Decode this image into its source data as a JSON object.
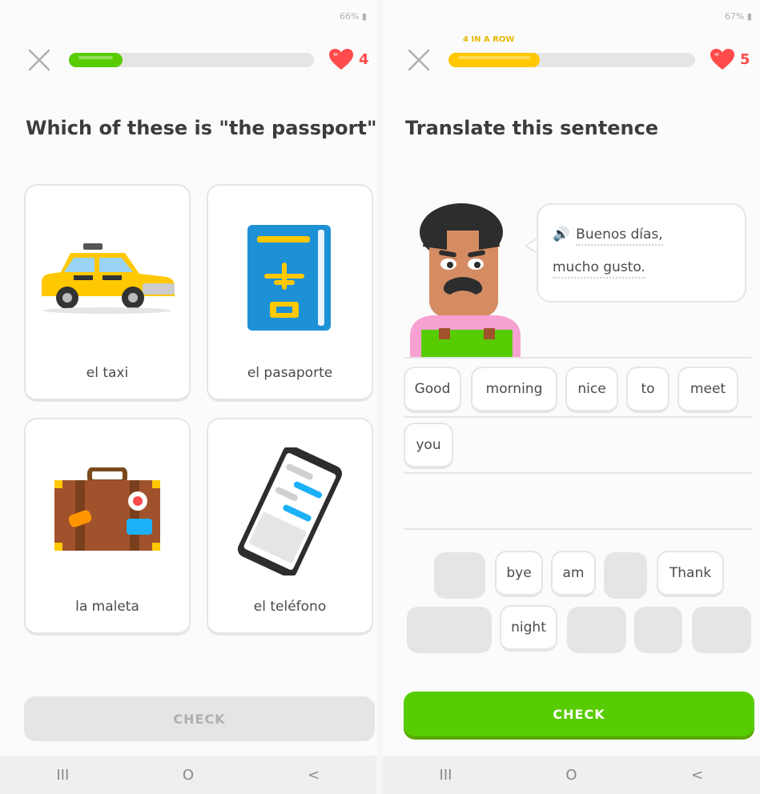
{
  "left": {
    "status": {
      "battery": "66%"
    },
    "progress": {
      "fraction": 0.22,
      "color": "#58cc02"
    },
    "hearts": {
      "count": "4"
    },
    "title": "Which of these is \"the passport\"?",
    "cards": [
      {
        "label": "el taxi",
        "icon": "taxi-icon"
      },
      {
        "label": "el pasaporte",
        "icon": "passport-icon"
      },
      {
        "label": "la maleta",
        "icon": "suitcase-icon"
      },
      {
        "label": "el teléfono",
        "icon": "phone-icon"
      }
    ],
    "check_label": "CHECK"
  },
  "right": {
    "status": {
      "battery": "67%"
    },
    "streak": "4 IN A ROW",
    "progress": {
      "fraction": 0.37,
      "color": "#ffc800"
    },
    "hearts": {
      "count": "5"
    },
    "title": "Translate this sentence",
    "bubble": {
      "line1": "Buenos días,",
      "line2": "mucho gusto."
    },
    "answer_words": [
      "Good",
      "morning",
      "nice",
      "to",
      "meet",
      "you"
    ],
    "word_bank": [
      "bye",
      "am",
      "Thank",
      "night"
    ],
    "check_label": "CHECK"
  },
  "colors": {
    "green": "#58cc02",
    "yellow": "#ffc800",
    "red": "#ff4b4b",
    "blue": "#1cb0f6"
  },
  "navbar": {
    "recent": "III",
    "home": "O",
    "back": "<"
  }
}
